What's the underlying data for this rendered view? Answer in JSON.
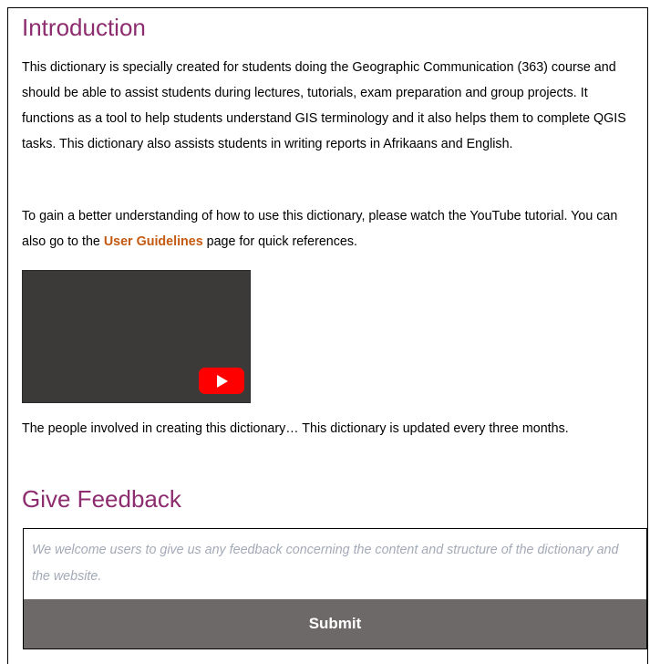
{
  "intro": {
    "heading": "Introduction",
    "paragraph1": "This dictionary is specially created for students doing the Geographic Communication (363) course and should be able to assist students during lectures, tutorials, exam preparation and group projects. It functions as a tool to help students understand GIS terminology and it also helps them to complete QGIS tasks. This dictionary also assists students in writing reports in Afrikaans and English.",
    "paragraph2_before": "To gain a better understanding of how to use this dictionary, please watch the YouTube tutorial. You can also go to the ",
    "guidelines_link": "User Guidelines",
    "paragraph2_after": " page for quick references.",
    "video_icon": "youtube-play-icon",
    "people_text": "The people involved in creating this dictionary… This dictionary is updated every three months."
  },
  "feedback": {
    "heading": "Give Feedback",
    "placeholder": "We welcome users to give us any feedback concerning the content and structure of the dictionary and the website.",
    "value": "",
    "submit_label": "Submit"
  },
  "colors": {
    "heading": "#8d2c6e",
    "link": "#c45a12",
    "video_bg": "#3b3a39",
    "play_red": "#ff0000",
    "submit_bg": "#6d6968",
    "placeholder": "#a3aab7"
  }
}
